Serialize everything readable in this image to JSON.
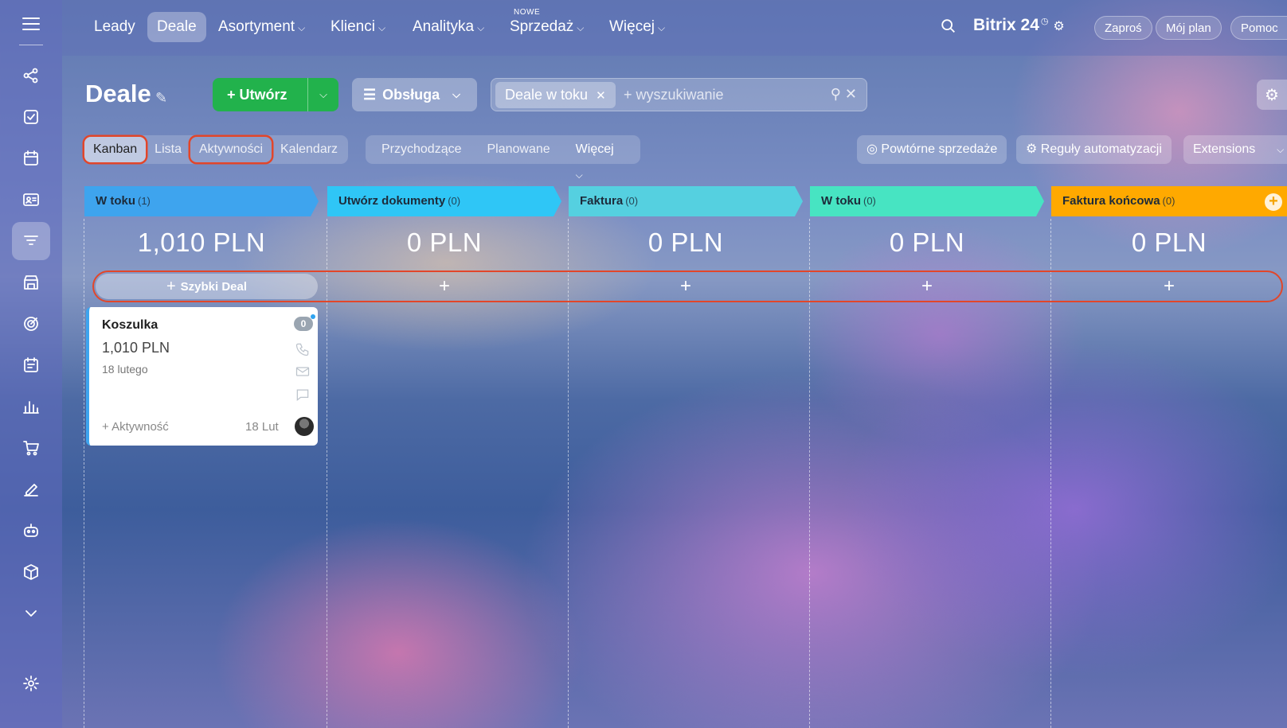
{
  "topnav": {
    "items": [
      {
        "label": "Leady"
      },
      {
        "label": "Deale"
      },
      {
        "label": "Asortyment"
      },
      {
        "label": "Klienci"
      },
      {
        "label": "Analityka"
      },
      {
        "label": "Sprzedaż"
      },
      {
        "label": "Więcej"
      }
    ],
    "new_badge": "NOWE",
    "brand": "Bitrix 24",
    "invite": "Zaproś",
    "my_plan": "Mój plan",
    "help": "Pomoc"
  },
  "sidebar": {
    "icons": [
      "crm-icon",
      "tasks-icon",
      "calendar-icon",
      "contacts-card-icon",
      "sales-funnel-icon",
      "store-icon",
      "target-icon",
      "planner-icon",
      "analytics-icon",
      "cart-icon",
      "sign-icon",
      "robot-icon",
      "box-icon",
      "chevron-down-icon"
    ],
    "active_index": 4
  },
  "toolbar": {
    "title": "Deale",
    "create_label": "Utwórz",
    "pipeline_label": "Obsługa",
    "filter_chip": "Deale w toku",
    "search_placeholder": "+ wyszukiwanie"
  },
  "views": {
    "tabs": [
      "Kanban",
      "Lista",
      "Aktywności",
      "Kalendarz"
    ],
    "active": "Kanban",
    "filters": [
      "Przychodzące",
      "Planowane",
      "Więcej"
    ],
    "repeat_sales": "Powtórne sprzedaże",
    "automation": "Reguły automatyzacji",
    "extensions": "Extensions"
  },
  "columns": [
    {
      "title": "W toku",
      "count": "(1)",
      "sum": "1,010 PLN",
      "color": "#3ea4ee"
    },
    {
      "title": "Utwórz dokumenty",
      "count": "(0)",
      "sum": "0 PLN",
      "color": "#2fc6f6"
    },
    {
      "title": "Faktura",
      "count": "(0)",
      "sum": "0 PLN",
      "color": "#55d0e0"
    },
    {
      "title": "W toku",
      "count": "(0)",
      "sum": "0 PLN",
      "color": "#47e4c2"
    },
    {
      "title": "Faktura końcowa",
      "count": "(0)",
      "sum": "0 PLN",
      "color": "#ffa900"
    }
  ],
  "quick_deal_label": "Szybki Deal",
  "card": {
    "title": "Koszulka",
    "price": "1,010 PLN",
    "date": "18 lutego",
    "badge": "0",
    "activity": "+ Aktywność",
    "short_date": "18 Lut"
  }
}
